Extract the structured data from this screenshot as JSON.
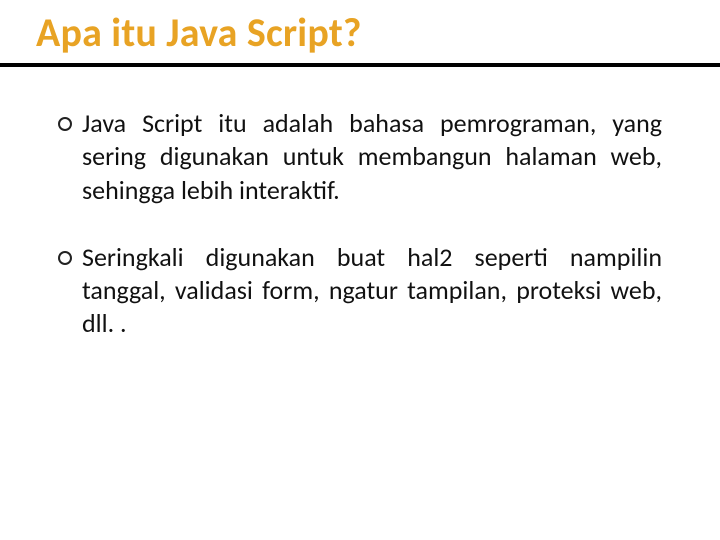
{
  "title": "Apa itu Java Script?",
  "bullets": [
    {
      "text": "Java Script itu adalah bahasa pemrograman, yang sering digunakan untuk membangun halaman web, sehingga lebih interaktif."
    },
    {
      "text": "Seringkali digunakan buat hal2 seperti nampilin tanggal, validasi form, ngatur tampilan, proteksi web, dll. ."
    }
  ]
}
